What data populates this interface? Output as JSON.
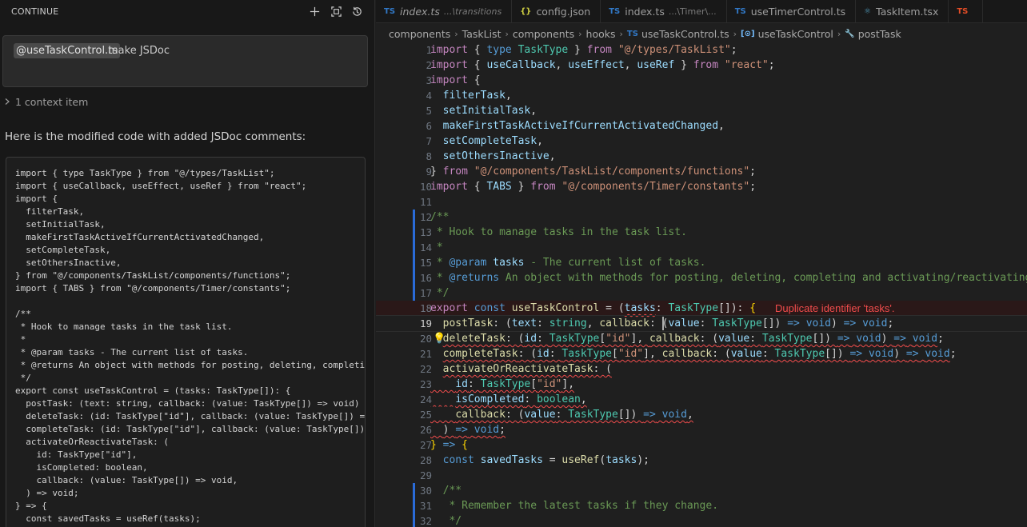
{
  "panel": {
    "title": "CONTINUE",
    "icons": [
      "plus-icon",
      "fullscreen-icon",
      "history-icon"
    ],
    "prompt": {
      "mention": "@useTaskControl.ts",
      "text": "make JSDoc"
    },
    "context_label": "1 context item",
    "response": "Here is the modified code with added JSDoc comments:",
    "code_lines": [
      "import { type TaskType } from \"@/types/TaskList\";",
      "import { useCallback, useEffect, useRef } from \"react\";",
      "import {",
      "  filterTask,",
      "  setInitialTask,",
      "  makeFirstTaskActiveIfCurrentActivatedChanged,",
      "  setCompleteTask,",
      "  setOthersInactive,",
      "} from \"@/components/TaskList/components/functions\";",
      "import { TABS } from \"@/components/Timer/constants\";",
      "",
      "/**",
      " * Hook to manage tasks in the task list.",
      " *",
      " * @param tasks - The current list of tasks.",
      " * @returns An object with methods for posting, deleting, completing and activating/reactivating tasks.",
      " */",
      "export const useTaskControl = (tasks: TaskType[]): {",
      "  postTask: (text: string, callback: (value: TaskType[]) => void) => void;",
      "  deleteTask: (id: TaskType[\"id\"], callback: (value: TaskType[]) => void) => void;",
      "  completeTask: (id: TaskType[\"id\"], callback: (value: TaskType[]) => void) => void;",
      "  activateOrReactivateTask: (",
      "    id: TaskType[\"id\"],",
      "    isCompleted: boolean,",
      "    callback: (value: TaskType[]) => void,",
      "  ) => void;",
      "} => {",
      "  const savedTasks = useRef(tasks);"
    ]
  },
  "tabs": [
    {
      "icon": "TS",
      "name": "index.ts",
      "desc": "...\\transitions",
      "italic": true,
      "kind": "ts"
    },
    {
      "icon": "{}",
      "name": "config.json",
      "desc": "",
      "italic": false,
      "kind": "json"
    },
    {
      "icon": "TS",
      "name": "index.ts",
      "desc": "...\\Timer\\...",
      "italic": false,
      "kind": "ts"
    },
    {
      "icon": "TS",
      "name": "useTimerControl.ts",
      "desc": "",
      "italic": false,
      "kind": "ts"
    },
    {
      "icon": "⚛",
      "name": "TaskItem.tsx",
      "desc": "",
      "italic": false,
      "kind": "tsx"
    },
    {
      "icon": "TS",
      "name": "",
      "desc": "",
      "italic": false,
      "kind": "last"
    }
  ],
  "breadcrumb": {
    "items": [
      "components",
      "TaskList",
      "components",
      "hooks",
      "useTaskControl.ts",
      "useTaskControl",
      "postTask"
    ]
  },
  "editor": {
    "line_numbers": [
      "1",
      "2",
      "3",
      "4",
      "5",
      "6",
      "7",
      "8",
      "9",
      "10",
      "11",
      "12",
      "13",
      "14",
      "15",
      "16",
      "17",
      "18",
      "19",
      "20",
      "21",
      "22",
      "23",
      "24",
      "25",
      "26",
      "27",
      "28",
      "29",
      "30",
      "31",
      "32"
    ],
    "active_line": "19",
    "error_message": "Duplicate identifier 'tasks'.",
    "tokens": {
      "import": "import",
      "type": "type",
      "from": "from",
      "export": "export",
      "const": "const",
      "TaskType": "TaskType",
      "useCallback": "useCallback",
      "useEffect": "useEffect",
      "useRef": "useRef",
      "s_types": "\"@/types/TaskList\"",
      "s_react": "\"react\"",
      "filterTask": "filterTask",
      "setInitialTask": "setInitialTask",
      "makeFirst": "makeFirstTaskActiveIfCurrentActivatedChanged",
      "setCompleteTask": "setCompleteTask",
      "setOthersInactive": "setOthersInactive",
      "s_functions": "\"@/components/TaskList/components/functions\"",
      "TABS": "TABS",
      "s_constants": "\"@/components/Timer/constants\"",
      "c12": "/**",
      "c13": " * Hook to manage tasks in the task list.",
      "c14": " *",
      "c15a": " * ",
      "param": "@param",
      "tasks": "tasks",
      "c15b": " - The current list of tasks.",
      "c16a": " * ",
      "returns": "@returns",
      "c16b": " An object with methods for posting, deleting, completing and activating/reactivating tasks.",
      "c17": " */",
      "useTaskControl": "useTaskControl",
      "postTask": "postTask",
      "text": "text",
      "string": "string",
      "callback": "callback",
      "value": "value",
      "void": "void",
      "deleteTask": "deleteTask",
      "id": "id",
      "s_id": "\"id\"",
      "completeTask": "completeTask",
      "activateOrReactivateTask": "activateOrReactivateTask",
      "isCompleted": "isCompleted",
      "boolean": "boolean",
      "savedTasks": "savedTasks",
      "c30": "/**",
      "c31": " * Remember the latest tasks if they change.",
      "c32": " */"
    }
  },
  "colors": {
    "background": "#1f1f1f",
    "keyword": "#569cd6",
    "control_keyword": "#c586c0",
    "type": "#4ec9b0",
    "function": "#dcdcaa",
    "variable": "#9cdcfe",
    "string": "#ce9178",
    "comment": "#6a9955",
    "error": "#f14c4c"
  }
}
